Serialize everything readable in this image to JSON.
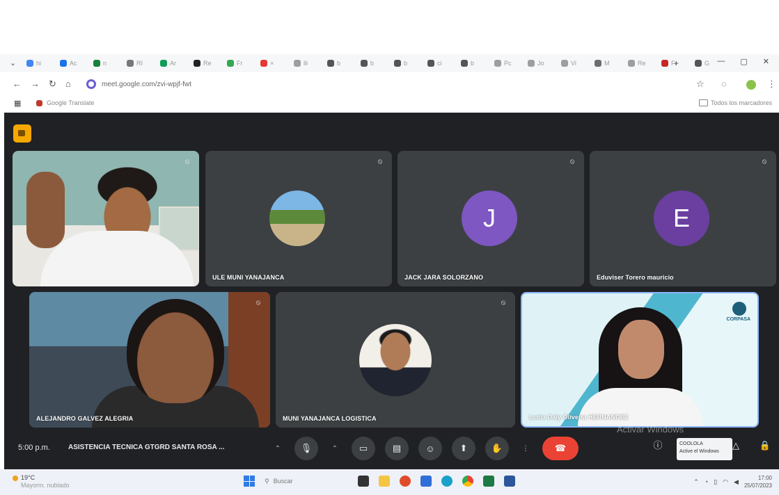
{
  "browser": {
    "tabs": [
      {
        "icon": "google-icon",
        "color": "#4285f4",
        "label": "hi"
      },
      {
        "icon": "docs-icon",
        "color": "#1a73e8",
        "label": "Ac"
      },
      {
        "icon": "meet-icon",
        "color": "#188038",
        "label": "n"
      },
      {
        "icon": "drive-icon",
        "color": "#777777",
        "label": "RI"
      },
      {
        "icon": "sheets-icon",
        "color": "#0f9d58",
        "label": "Ar"
      },
      {
        "icon": "github-icon",
        "color": "#222222",
        "label": "Re"
      },
      {
        "icon": "calendar-icon",
        "color": "#34a853",
        "label": "Fr"
      },
      {
        "icon": "youtube-icon",
        "color": "#e53935",
        "label": "×"
      },
      {
        "icon": "tab-icon",
        "color": "#9e9e9e",
        "label": "lli"
      },
      {
        "icon": "chrome-icon",
        "color": "#555555",
        "label": "b"
      },
      {
        "icon": "chrome-icon",
        "color": "#555555",
        "label": "b"
      },
      {
        "icon": "chrome-icon",
        "color": "#555555",
        "label": "b"
      },
      {
        "icon": "chrome-icon",
        "color": "#555555",
        "label": "ci"
      },
      {
        "icon": "chrome-icon",
        "color": "#555555",
        "label": "b"
      },
      {
        "icon": "tab-icon",
        "color": "#9e9e9e",
        "label": "Pc"
      },
      {
        "icon": "tab-icon",
        "color": "#9e9e9e",
        "label": "Jo"
      },
      {
        "icon": "tab-icon",
        "color": "#9e9e9e",
        "label": "Vi"
      },
      {
        "icon": "tab-icon",
        "color": "#6d6d6d",
        "label": "M"
      },
      {
        "icon": "tab-icon",
        "color": "#9e9e9e",
        "label": "Re"
      },
      {
        "icon": "tab-icon",
        "color": "#c62828",
        "label": "Fr"
      },
      {
        "icon": "chrome-icon",
        "color": "#555555",
        "label": "G"
      }
    ],
    "url": "meet.google.com/zvi-wpjf-fwt",
    "bookmark": "Google Translate",
    "all_bookmarks": "Todos los marcadores"
  },
  "meet": {
    "participants": [
      {
        "name": "",
        "type": "video"
      },
      {
        "name": "ULE MUNI YANAJANCA",
        "type": "photo"
      },
      {
        "name": "JACK JARA SOLORZANO",
        "type": "initial",
        "initial": "J",
        "color": "#7e57c2"
      },
      {
        "name": "Eduviser Torero mauricio",
        "type": "initial",
        "initial": "E",
        "color": "#6a3fa0"
      },
      {
        "name": "ALEJANDRO GALVEZ ALEGRIA",
        "type": "video"
      },
      {
        "name": "MUNI YANAJANCA LOGISTICA",
        "type": "photo"
      },
      {
        "name": "Lucia Daly Oliveira HERNANDEZ",
        "type": "video"
      }
    ],
    "time": "5:00 p.m.",
    "meeting_title": "ASISTENCIA TECNICA GTGRD SANTA ROSA ...",
    "tooltip": {
      "line1": "COOLOLA",
      "line2": "Active el Windows"
    },
    "activate_text": "Activar Windows",
    "camera_logo": "CORPASA"
  },
  "taskbar": {
    "weather_temp": "19°C",
    "weather_desc": "Mayorm. nublado",
    "search_placeholder": "Buscar",
    "clock_time": "17:00",
    "clock_date": "25/07/2023"
  }
}
